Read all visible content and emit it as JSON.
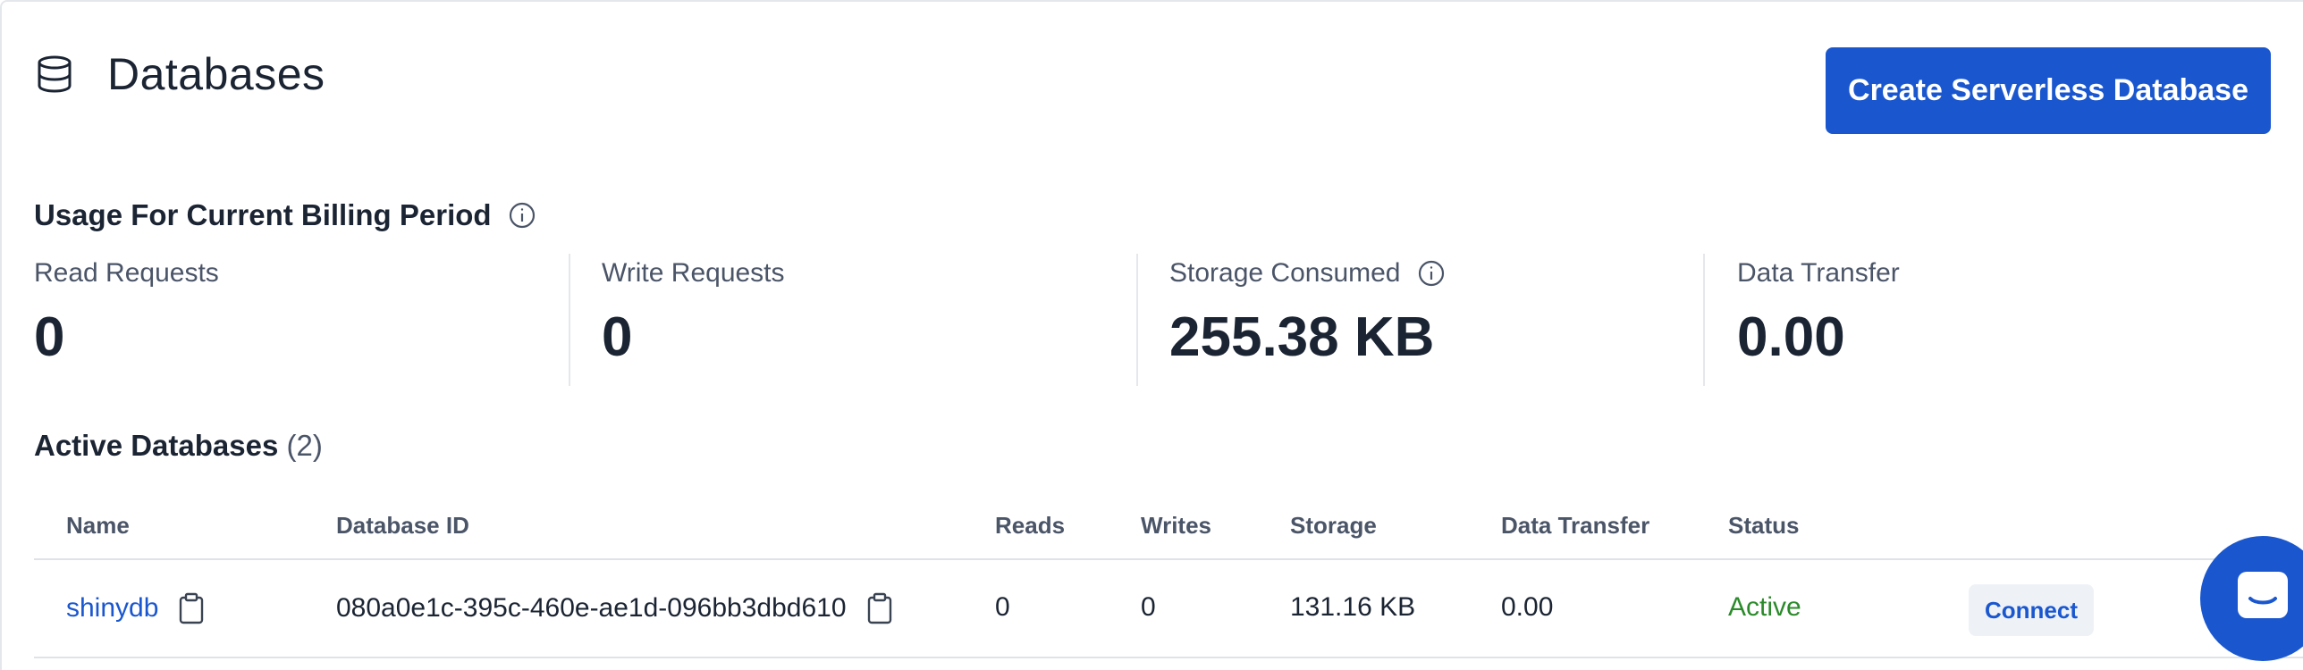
{
  "header": {
    "title": "Databases",
    "icon": "database-icon",
    "create_button_label": "Create Serverless Database"
  },
  "usage": {
    "title": "Usage For Current Billing Period",
    "stats": [
      {
        "label": "Read Requests",
        "value": "0"
      },
      {
        "label": "Write Requests",
        "value": "0"
      },
      {
        "label": "Storage Consumed",
        "value": "255.38 KB"
      },
      {
        "label": "Data Transfer",
        "value": "0.00"
      }
    ]
  },
  "active": {
    "title": "Active Databases",
    "count": "(2)",
    "columns": [
      "Name",
      "Database ID",
      "Reads",
      "Writes",
      "Storage",
      "Data Transfer",
      "Status"
    ],
    "rows": [
      {
        "name": "shinydb",
        "id": "080a0e1c-395c-460e-ae1d-096bb3dbd610",
        "reads": "0",
        "writes": "0",
        "storage": "131.16 KB",
        "data_transfer": "0.00",
        "status": "Active",
        "connect_label": "Connect"
      }
    ]
  },
  "colors": {
    "accent": "#1a57cf",
    "status_active": "#2b8a2b",
    "text_primary": "#1b2433",
    "text_secondary": "#4b5568"
  }
}
